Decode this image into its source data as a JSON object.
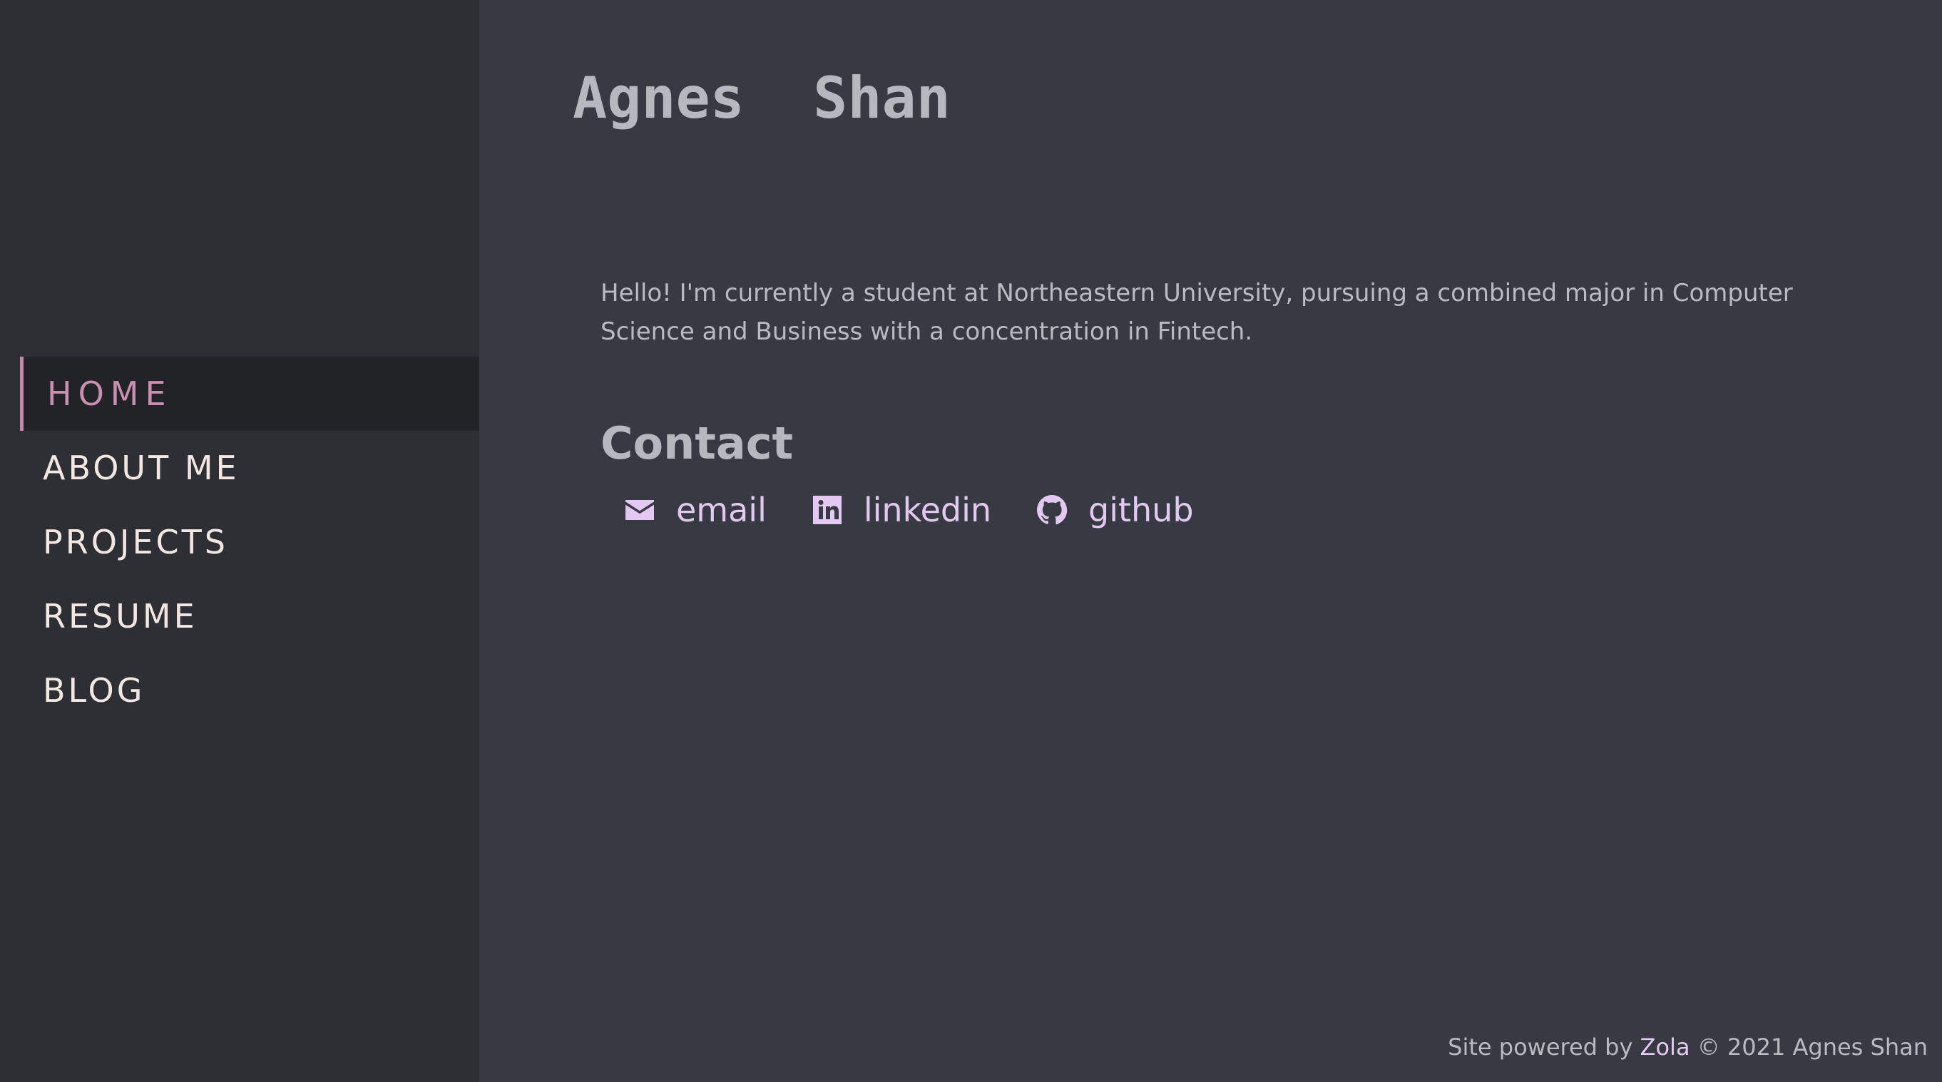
{
  "sidebar": {
    "nav": [
      {
        "label": "HOME",
        "active": true
      },
      {
        "label": "ABOUT ME",
        "active": false
      },
      {
        "label": "PROJECTS",
        "active": false
      },
      {
        "label": "RESUME",
        "active": false
      },
      {
        "label": "BLOG",
        "active": false
      }
    ]
  },
  "main": {
    "site_title": "Agnes  Shan",
    "intro": "Hello! I'm currently a student at Northeastern University, pursuing a combined major in Computer Science and Business with a concentration in Fintech.",
    "contact_heading": "Contact",
    "contact_links": [
      {
        "icon": "envelope-icon",
        "label": "email"
      },
      {
        "icon": "linkedin-icon",
        "label": "linkedin"
      },
      {
        "icon": "github-icon",
        "label": "github"
      }
    ]
  },
  "footer": {
    "prefix": "Site powered by",
    "link": "Zola",
    "suffix": "© 2021 Agnes Shan"
  },
  "colors": {
    "background": "#373a43",
    "sidebar": "#2d2f35",
    "active_item_bg": "#222327",
    "accent": "#c98fb0",
    "link": "#e3c8f1",
    "nav_text": "#f3e7e2",
    "body_text": "#b9bbc2"
  }
}
